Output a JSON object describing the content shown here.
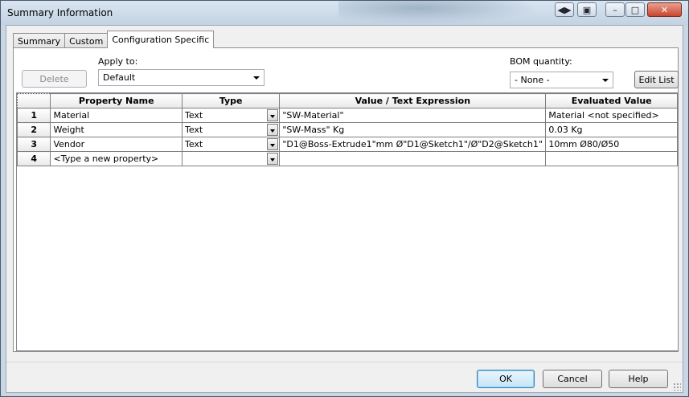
{
  "window": {
    "title": "Summary Information",
    "controls": [
      "restore-icon",
      "pin-icon",
      "minimize-icon",
      "maximize-icon",
      "close-icon"
    ]
  },
  "tabs": [
    {
      "label": "Summary"
    },
    {
      "label": "Custom"
    },
    {
      "label": "Configuration Specific",
      "active": true
    }
  ],
  "toolbar": {
    "delete_label": "Delete",
    "apply_to_label": "Apply to:",
    "apply_to_value": "Default",
    "bom_quantity_label": "BOM quantity:",
    "bom_quantity_value": "- None -",
    "edit_list_label": "Edit List"
  },
  "grid": {
    "columns": [
      "Property Name",
      "Type",
      "Value / Text Expression",
      "Evaluated Value"
    ],
    "rows": [
      {
        "num": "1",
        "name": "Material",
        "type": "Text",
        "value": "\"SW-Material\"",
        "evaluated": "Material <not specified>"
      },
      {
        "num": "2",
        "name": "Weight",
        "type": "Text",
        "value": "\"SW-Mass\" Kg",
        "evaluated": "0.03 Kg"
      },
      {
        "num": "3",
        "name": "Vendor",
        "type": "Text",
        "value": "\"D1@Boss-Extrude1\"mm  Ø\"D1@Sketch1\"/Ø\"D2@Sketch1\"",
        "evaluated": "10mm  Ø80/Ø50"
      },
      {
        "num": "4",
        "name": "<Type a new property>",
        "type": "",
        "value": "",
        "evaluated": ""
      }
    ]
  },
  "footer": {
    "ok_label": "OK",
    "cancel_label": "Cancel",
    "help_label": "Help"
  },
  "colors": {
    "window_frame": "#c9d6e4",
    "close_button": "#c9452c",
    "default_button_border": "#3c7fb1"
  }
}
